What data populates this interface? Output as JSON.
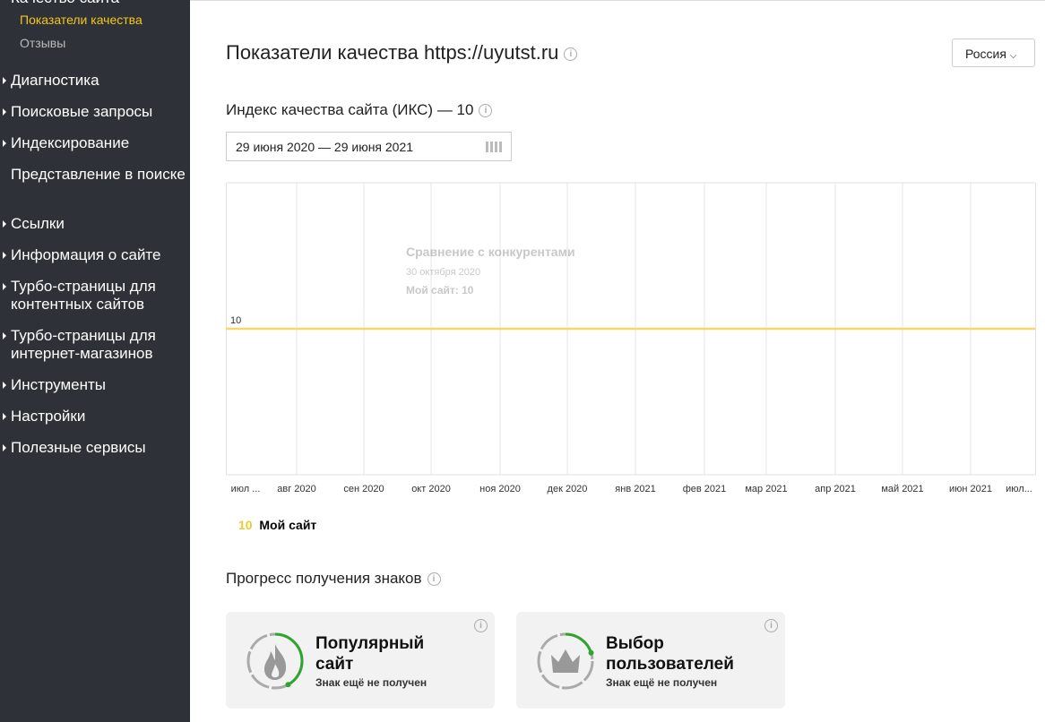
{
  "sidebar": {
    "section_partial": "Качество сайта",
    "sub_items": [
      {
        "label": "Показатели качества",
        "active": true
      },
      {
        "label": "Отзывы",
        "active": false
      }
    ],
    "items": [
      {
        "label": "Диагностика",
        "arrow": true
      },
      {
        "label": "Поисковые запросы",
        "arrow": true
      },
      {
        "label": "Индексирование",
        "arrow": true
      },
      {
        "label": "Представление в поиске",
        "arrow": false
      },
      {
        "label": "Ссылки",
        "arrow": true
      },
      {
        "label": "Информация о сайте",
        "arrow": true
      },
      {
        "label": "Турбо-страницы для контентных сайтов",
        "arrow": true
      },
      {
        "label": "Турбо-страницы для интернет-магазинов",
        "arrow": true
      },
      {
        "label": "Инструменты",
        "arrow": true
      },
      {
        "label": "Настройки",
        "arrow": true
      },
      {
        "label": "Полезные сервисы",
        "arrow": true
      }
    ]
  },
  "header": {
    "title": "Показатели качества https://uyutst.ru",
    "region": "Россия"
  },
  "iks": {
    "title": "Индекс качества сайта (ИКС) — 10",
    "date_range": "29 июня 2020 — 29 июня 2021"
  },
  "chart_data": {
    "type": "line",
    "x": [
      "июл ...",
      "авг 2020",
      "сен 2020",
      "окт 2020",
      "ноя 2020",
      "дек 2020",
      "янв 2021",
      "фев 2021",
      "мар 2021",
      "апр 2021",
      "май 2021",
      "июн 2021",
      "июл..."
    ],
    "series": [
      {
        "name": "Мой сайт",
        "color": "#f5d76e",
        "values": [
          10,
          10,
          10,
          10,
          10,
          10,
          10,
          10,
          10,
          10,
          10,
          10,
          10
        ]
      }
    ],
    "y_label_value": "10",
    "ylim": [
      0,
      20
    ],
    "tooltip": {
      "title": "Сравнение с конкурентами",
      "date": "30 октября 2020",
      "entry": "Мой сайт: 10"
    },
    "legend": {
      "value": "10",
      "label": "Мой сайт"
    }
  },
  "badges": {
    "title": "Прогресс получения знаков",
    "items": [
      {
        "title1": "Популярный",
        "title2": "сайт",
        "status": "Знак ещё не получен",
        "progress": 0.42,
        "icon": "flame-icon"
      },
      {
        "title1": "Выбор",
        "title2": "пользователей",
        "status": "Знак ещё не получен",
        "progress": 0.2,
        "icon": "crown-icon"
      }
    ]
  }
}
